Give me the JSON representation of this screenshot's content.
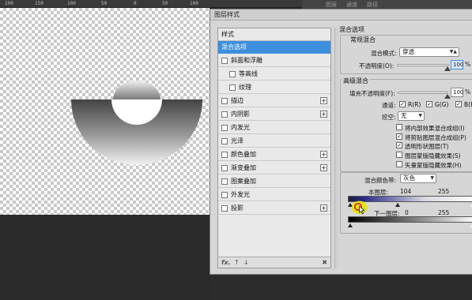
{
  "ruler": {
    "ticks": [
      "200",
      "150",
      "100",
      "50",
      "0",
      "50",
      "100",
      "150",
      "200"
    ]
  },
  "topbar": {
    "tabs": [
      "图层",
      "通道",
      "路径"
    ]
  },
  "dialog": {
    "title": "图层样式",
    "styles_header": "样式",
    "styles": [
      {
        "label": "混合选项",
        "checkbox": false,
        "plus": false,
        "selected": true
      },
      {
        "label": "斜面和浮雕",
        "checkbox": true,
        "plus": false
      },
      {
        "label": "等高线",
        "checkbox": true,
        "plus": false,
        "indent": true
      },
      {
        "label": "纹理",
        "checkbox": true,
        "plus": false,
        "indent": true
      },
      {
        "label": "描边",
        "checkbox": true,
        "plus": true
      },
      {
        "label": "内阴影",
        "checkbox": true,
        "plus": true
      },
      {
        "label": "内发光",
        "checkbox": true,
        "plus": false
      },
      {
        "label": "光泽",
        "checkbox": true,
        "plus": false
      },
      {
        "label": "颜色叠加",
        "checkbox": true,
        "plus": true
      },
      {
        "label": "渐变叠加",
        "checkbox": true,
        "plus": true
      },
      {
        "label": "图案叠加",
        "checkbox": true,
        "plus": false
      },
      {
        "label": "外发光",
        "checkbox": true,
        "plus": false
      },
      {
        "label": "投影",
        "checkbox": true,
        "plus": true
      }
    ],
    "footer_icons": [
      "fx-icon",
      "up-arrow-icon",
      "down-arrow-icon",
      "trash-icon"
    ],
    "footer_fx": "fx.",
    "blend_options": {
      "section_title": "混合选项",
      "general_title": "常规混合",
      "blend_mode_label": "混合模式:",
      "blend_mode_value": "穿透",
      "opacity_label": "不透明度(O):",
      "opacity_value": "100",
      "unit": "%",
      "advanced_title": "高级混合",
      "fill_opacity_label": "填充不透明度(F):",
      "fill_opacity_value": "100",
      "channels_label": "通道:",
      "channels": [
        {
          "label": "R(R)",
          "checked": true
        },
        {
          "label": "G(G)",
          "checked": true
        },
        {
          "label": "B(B)",
          "checked": true
        }
      ],
      "knockout_label": "挖空:",
      "knockout_value": "无",
      "options": [
        {
          "label": "将内部效果混合成组(I)",
          "checked": false
        },
        {
          "label": "将剪贴图层混合成组(P)",
          "checked": true
        },
        {
          "label": "透明形状图层(T)",
          "checked": true
        },
        {
          "label": "图层蒙版隐藏效果(S)",
          "checked": false
        },
        {
          "label": "矢量蒙版隐藏效果(H)",
          "checked": false
        }
      ],
      "blend_if_label": "混合颜色带:",
      "blend_if_value": "灰色",
      "this_layer_label": "本图层:",
      "this_layer_low": "104",
      "this_layer_high": "255",
      "under_layer_label": "下一图层:",
      "under_layer_low": "0",
      "under_layer_high": "255"
    }
  }
}
